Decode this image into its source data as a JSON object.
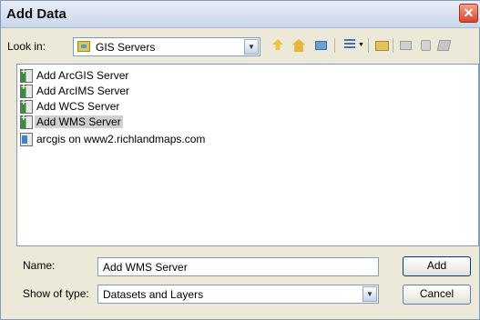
{
  "window": {
    "title": "Add Data",
    "close_symbol": "✕"
  },
  "lookin": {
    "label": "Look in:",
    "value": "GIS Servers",
    "icon": "gis-servers-folder-icon"
  },
  "toolbar": {
    "icons": [
      "up-one-level-icon",
      "home-icon",
      "connect-to-folder-icon",
      "list-view-icon",
      "view-options-dropdown-icon",
      "new-folder-icon",
      "disabled-tool-icon",
      "disabled-tool-icon",
      "disabled-tool-icon"
    ]
  },
  "list": {
    "items": [
      {
        "label": "Add ArcGIS Server",
        "icon": "add-server-icon",
        "selected": false
      },
      {
        "label": "Add ArcIMS Server",
        "icon": "add-server-icon",
        "selected": false
      },
      {
        "label": "Add WCS Server",
        "icon": "add-server-icon",
        "selected": false
      },
      {
        "label": "Add WMS Server",
        "icon": "add-server-icon",
        "selected": true
      },
      {
        "label": "arcgis on www2.richlandmaps.com",
        "icon": "server-connection-icon",
        "selected": false
      }
    ]
  },
  "name_field": {
    "label": "Name:",
    "value": "Add WMS Server"
  },
  "type_field": {
    "label": "Show of type:",
    "value": "Datasets and Layers"
  },
  "buttons": {
    "add": "Add",
    "cancel": "Cancel"
  }
}
